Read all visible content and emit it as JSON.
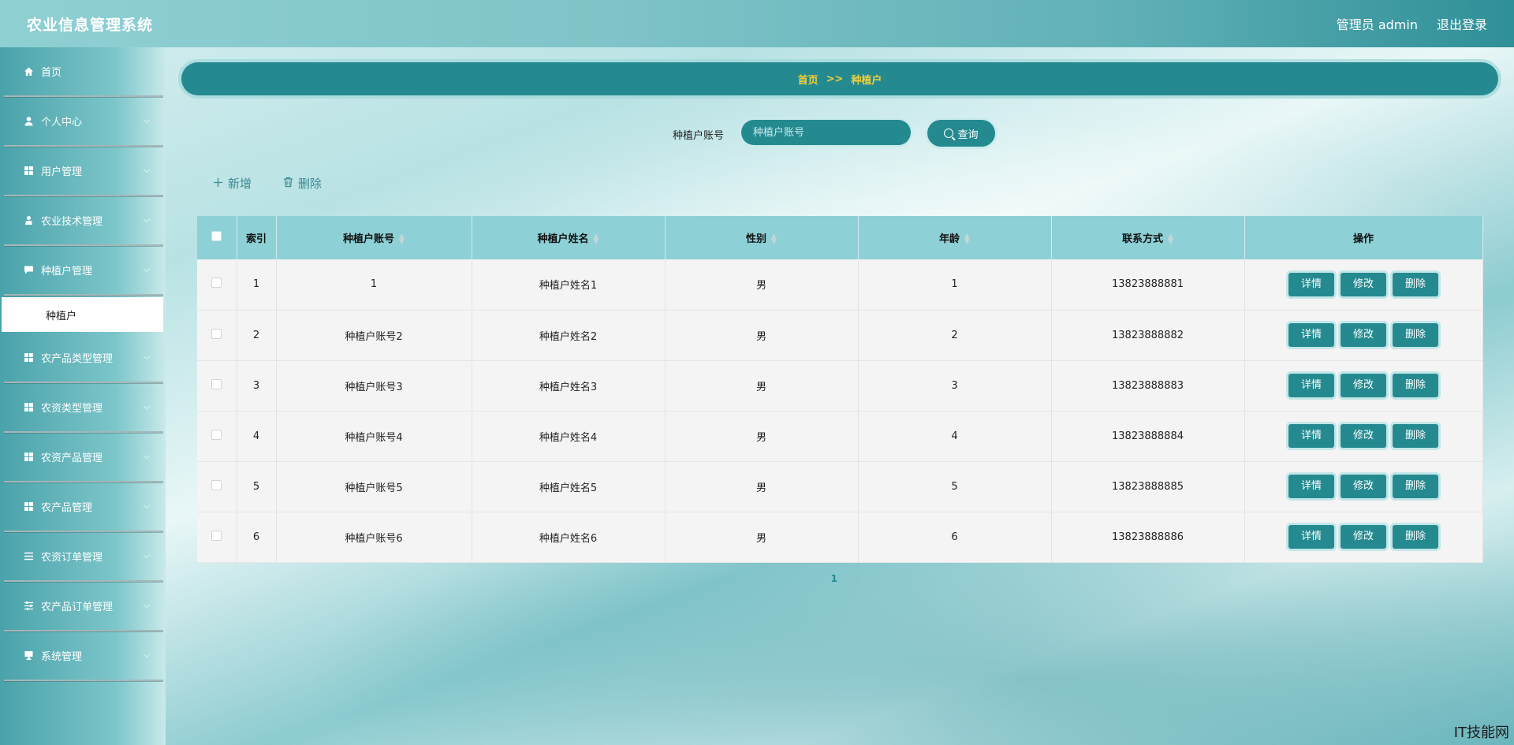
{
  "app_title": "农业信息管理系统",
  "header": {
    "user_label": "管理员 admin",
    "logout_label": "退出登录"
  },
  "sidebar": {
    "items": [
      {
        "label": "首页",
        "icon": "home-icon",
        "expandable": false
      },
      {
        "label": "个人中心",
        "icon": "user-icon",
        "expandable": true
      },
      {
        "label": "用户管理",
        "icon": "grid-icon",
        "expandable": true
      },
      {
        "label": "农业技术管理",
        "icon": "person-icon",
        "expandable": true
      },
      {
        "label": "种植户管理",
        "icon": "chat-icon",
        "expandable": true
      },
      {
        "label": "农产品类型管理",
        "icon": "grid-icon",
        "expandable": true
      },
      {
        "label": "农资类型管理",
        "icon": "grid-icon",
        "expandable": true
      },
      {
        "label": "农资产品管理",
        "icon": "grid-icon",
        "expandable": true
      },
      {
        "label": "农产品管理",
        "icon": "grid-icon",
        "expandable": true
      },
      {
        "label": "农资订单管理",
        "icon": "list-icon",
        "expandable": true
      },
      {
        "label": "农产品订单管理",
        "icon": "sliders-icon",
        "expandable": true
      },
      {
        "label": "系统管理",
        "icon": "monitor-icon",
        "expandable": true
      }
    ],
    "active_sub": "种植户"
  },
  "breadcrumb": {
    "home": "首页",
    "separator": ">>",
    "current": "种植户"
  },
  "search": {
    "label": "种植户账号",
    "placeholder": "种植户账号",
    "button": "查询"
  },
  "actions": {
    "add": "新增",
    "delete": "删除"
  },
  "table": {
    "columns": [
      "索引",
      "种植户账号",
      "种植户姓名",
      "性别",
      "年龄",
      "联系方式",
      "操作"
    ],
    "rows": [
      {
        "index": "1",
        "account": "1",
        "name": "种植户姓名1",
        "gender": "男",
        "age": "1",
        "phone": "13823888881"
      },
      {
        "index": "2",
        "account": "种植户账号2",
        "name": "种植户姓名2",
        "gender": "男",
        "age": "2",
        "phone": "13823888882"
      },
      {
        "index": "3",
        "account": "种植户账号3",
        "name": "种植户姓名3",
        "gender": "男",
        "age": "3",
        "phone": "13823888883"
      },
      {
        "index": "4",
        "account": "种植户账号4",
        "name": "种植户姓名4",
        "gender": "男",
        "age": "4",
        "phone": "13823888884"
      },
      {
        "index": "5",
        "account": "种植户账号5",
        "name": "种植户姓名5",
        "gender": "男",
        "age": "5",
        "phone": "13823888885"
      },
      {
        "index": "6",
        "account": "种植户账号6",
        "name": "种植户姓名6",
        "gender": "男",
        "age": "6",
        "phone": "13823888886"
      }
    ],
    "op_labels": {
      "detail": "详情",
      "edit": "修改",
      "delete": "删除"
    }
  },
  "pagination": {
    "current_page": "1"
  },
  "watermark": "IT技能网",
  "colors": {
    "primary": "#248a90",
    "breadcrumb_text": "#f1cf3a",
    "header_row": "#8dd0d6"
  }
}
